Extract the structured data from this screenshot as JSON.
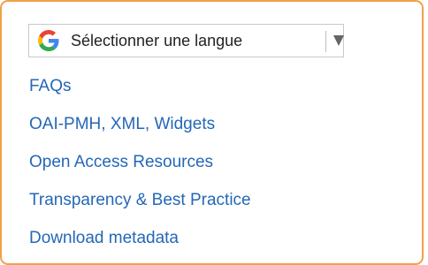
{
  "language_selector": {
    "label": "Sélectionner une langue",
    "icon": "google-g-icon",
    "dropdown_icon": "triangle-down-icon"
  },
  "links": [
    {
      "label": "FAQs"
    },
    {
      "label": "OAI-PMH, XML, Widgets"
    },
    {
      "label": "Open Access Resources"
    },
    {
      "label": "Transparency & Best Practice"
    },
    {
      "label": "Download metadata"
    }
  ],
  "colors": {
    "panel_border": "#f0a04b",
    "link": "#2467b7",
    "text": "#222222"
  }
}
